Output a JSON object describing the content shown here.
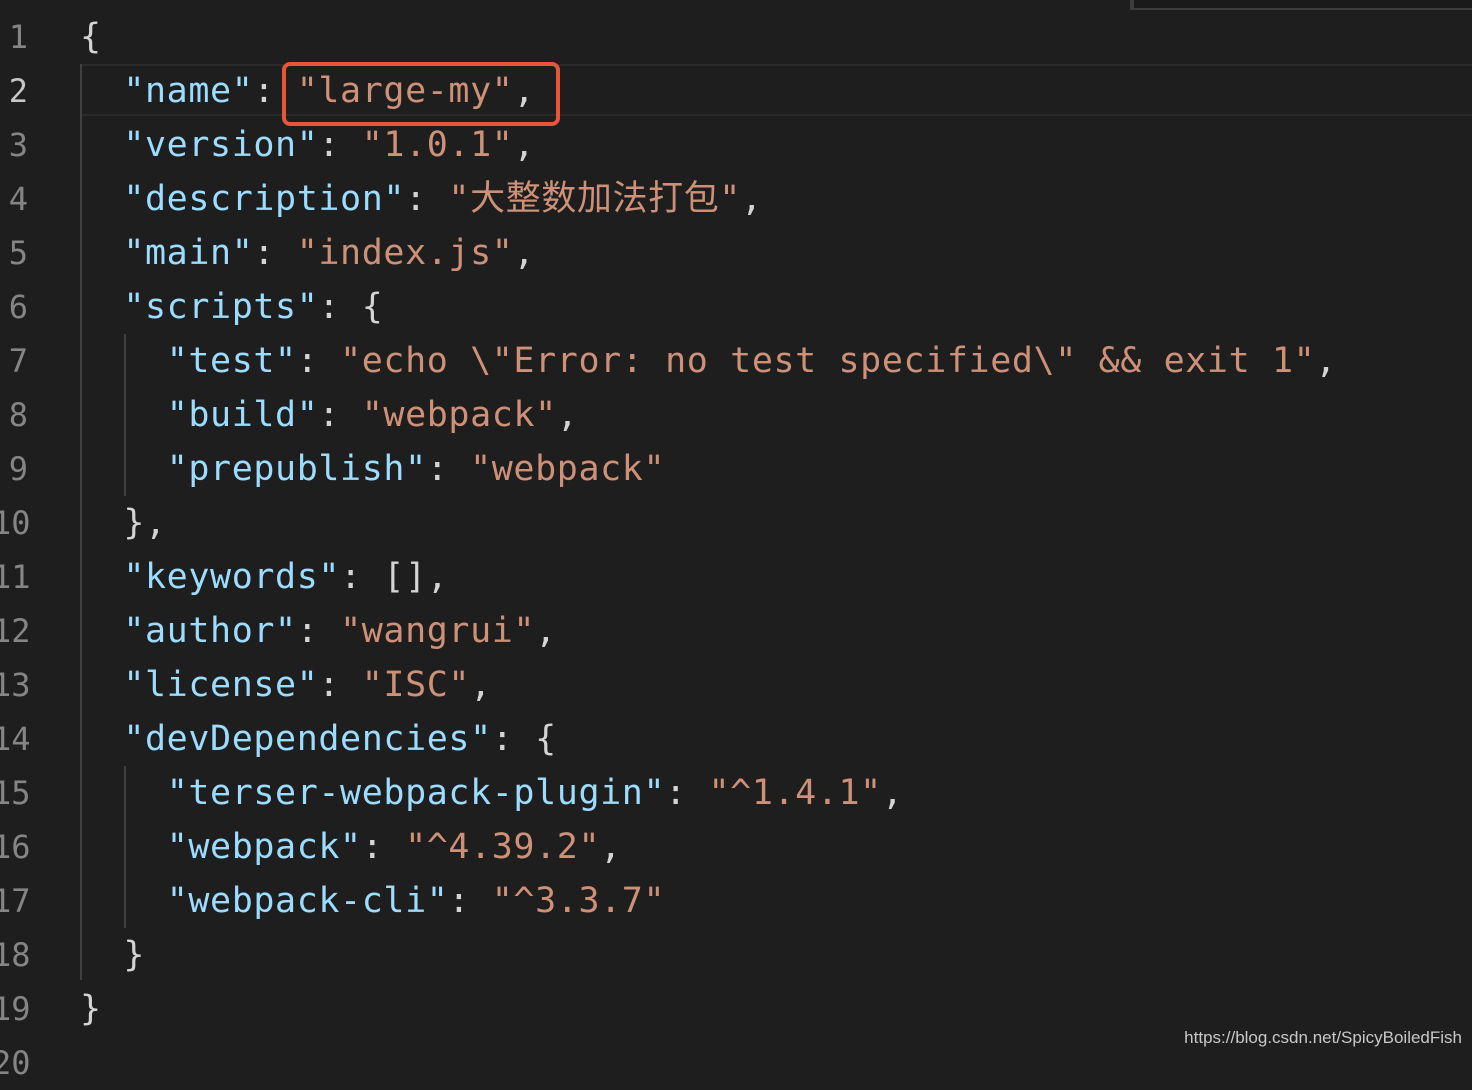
{
  "editor": {
    "active_line": 2,
    "lines": [
      {
        "n": "1",
        "indent": "",
        "tokens": [
          {
            "t": "{",
            "c": "p"
          }
        ]
      },
      {
        "n": "2",
        "indent": "  ",
        "tokens": [
          {
            "t": "\"name\"",
            "c": "k"
          },
          {
            "t": ": ",
            "c": "p"
          },
          {
            "t": "\"large-my\"",
            "c": "s"
          },
          {
            "t": ",",
            "c": "p"
          }
        ]
      },
      {
        "n": "3",
        "indent": "  ",
        "tokens": [
          {
            "t": "\"version\"",
            "c": "k"
          },
          {
            "t": ": ",
            "c": "p"
          },
          {
            "t": "\"1.0.1\"",
            "c": "s"
          },
          {
            "t": ",",
            "c": "p"
          }
        ]
      },
      {
        "n": "4",
        "indent": "  ",
        "tokens": [
          {
            "t": "\"description\"",
            "c": "k"
          },
          {
            "t": ": ",
            "c": "p"
          },
          {
            "t": "\"大整数加法打包\"",
            "c": "s"
          },
          {
            "t": ",",
            "c": "p"
          }
        ]
      },
      {
        "n": "5",
        "indent": "  ",
        "tokens": [
          {
            "t": "\"main\"",
            "c": "k"
          },
          {
            "t": ": ",
            "c": "p"
          },
          {
            "t": "\"index.js\"",
            "c": "s"
          },
          {
            "t": ",",
            "c": "p"
          }
        ]
      },
      {
        "n": "6",
        "indent": "  ",
        "tokens": [
          {
            "t": "\"scripts\"",
            "c": "k"
          },
          {
            "t": ": {",
            "c": "p"
          }
        ]
      },
      {
        "n": "7",
        "indent": "    ",
        "tokens": [
          {
            "t": "\"test\"",
            "c": "k"
          },
          {
            "t": ": ",
            "c": "p"
          },
          {
            "t": "\"echo \\\"Error: no test specified\\\" && exit 1\"",
            "c": "s"
          },
          {
            "t": ",",
            "c": "p"
          }
        ]
      },
      {
        "n": "8",
        "indent": "    ",
        "tokens": [
          {
            "t": "\"build\"",
            "c": "k"
          },
          {
            "t": ": ",
            "c": "p"
          },
          {
            "t": "\"webpack\"",
            "c": "s"
          },
          {
            "t": ",",
            "c": "p"
          }
        ]
      },
      {
        "n": "9",
        "indent": "    ",
        "tokens": [
          {
            "t": "\"prepublish\"",
            "c": "k"
          },
          {
            "t": ": ",
            "c": "p"
          },
          {
            "t": "\"webpack\"",
            "c": "s"
          }
        ]
      },
      {
        "n": "10",
        "indent": "  ",
        "tokens": [
          {
            "t": "},",
            "c": "p"
          }
        ]
      },
      {
        "n": "11",
        "indent": "  ",
        "tokens": [
          {
            "t": "\"keywords\"",
            "c": "k"
          },
          {
            "t": ": [],",
            "c": "p"
          }
        ]
      },
      {
        "n": "12",
        "indent": "  ",
        "tokens": [
          {
            "t": "\"author\"",
            "c": "k"
          },
          {
            "t": ": ",
            "c": "p"
          },
          {
            "t": "\"wangrui\"",
            "c": "s"
          },
          {
            "t": ",",
            "c": "p"
          }
        ]
      },
      {
        "n": "13",
        "indent": "  ",
        "tokens": [
          {
            "t": "\"license\"",
            "c": "k"
          },
          {
            "t": ": ",
            "c": "p"
          },
          {
            "t": "\"ISC\"",
            "c": "s"
          },
          {
            "t": ",",
            "c": "p"
          }
        ]
      },
      {
        "n": "14",
        "indent": "  ",
        "tokens": [
          {
            "t": "\"devDependencies\"",
            "c": "k"
          },
          {
            "t": ": {",
            "c": "p"
          }
        ]
      },
      {
        "n": "15",
        "indent": "    ",
        "tokens": [
          {
            "t": "\"terser-webpack-plugin\"",
            "c": "k"
          },
          {
            "t": ": ",
            "c": "p"
          },
          {
            "t": "\"^1.4.1\"",
            "c": "s"
          },
          {
            "t": ",",
            "c": "p"
          }
        ]
      },
      {
        "n": "16",
        "indent": "    ",
        "tokens": [
          {
            "t": "\"webpack\"",
            "c": "k"
          },
          {
            "t": ": ",
            "c": "p"
          },
          {
            "t": "\"^4.39.2\"",
            "c": "s"
          },
          {
            "t": ",",
            "c": "p"
          }
        ]
      },
      {
        "n": "17",
        "indent": "    ",
        "tokens": [
          {
            "t": "\"webpack-cli\"",
            "c": "k"
          },
          {
            "t": ": ",
            "c": "p"
          },
          {
            "t": "\"^3.3.7\"",
            "c": "s"
          }
        ]
      },
      {
        "n": "18",
        "indent": "  ",
        "tokens": [
          {
            "t": "}",
            "c": "p"
          }
        ]
      },
      {
        "n": "19",
        "indent": "",
        "tokens": [
          {
            "t": "}",
            "c": "p"
          }
        ]
      },
      {
        "n": "20",
        "indent": "",
        "tokens": []
      }
    ]
  },
  "colors": {
    "background": "#1e1e1e",
    "key": "#9cdcfe",
    "string": "#ce9178",
    "punctuation": "#d4d4d4",
    "highlight_box": "#e8553a"
  },
  "watermark": "https://blog.csdn.net/SpicyBoiledFish"
}
